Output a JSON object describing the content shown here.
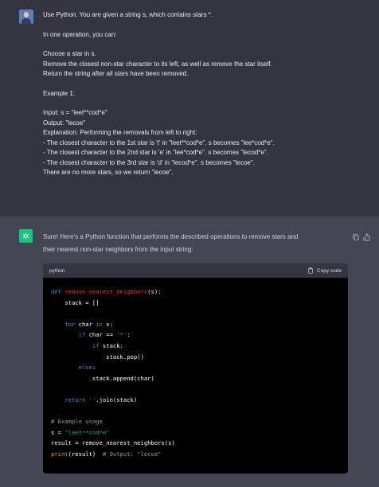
{
  "user_message": {
    "avatar": "user-avatar",
    "lines": [
      "Use Python. You are given a string s, which contains stars *.",
      "",
      "In one operation, you can:",
      "",
      "Choose a star in s.",
      "Remove the closest non-star character to its left, as well as remove the star itself.",
      "Return the string after all stars have been removed.",
      "",
      "Example 1:",
      "",
      "Input: s = \"leet**cod*e\"",
      "Output: \"lecoe\"",
      "Explanation: Performing the removals from left to right:",
      "- The closest character to the 1st star is 't' in \"leet**cod*e\". s becomes \"lee*cod*e\".",
      "- The closest character to the 2nd star is 'e' in \"lee*cod*e\". s becomes \"lecod*e\".",
      "- The closest character to the 3rd star is 'd' in \"lecod*e\". s becomes \"lecoe\".",
      "There are no more stars, so we return \"lecoe\"."
    ]
  },
  "assistant_message": {
    "avatar": "openai-logo-icon",
    "intro_line_1": "Sure! Here's a Python function that performs the described operations to remove stars and",
    "intro_line_2": "their nearest non-star neighbors from the input string:",
    "actions": [
      "copy-icon",
      "thumbs-up-icon"
    ]
  },
  "code_block": {
    "language": "python",
    "copy_label": "Copy code",
    "lines": [
      [
        [
          "kw",
          "def "
        ],
        [
          "fn",
          "remove_nearest_neighbors"
        ],
        [
          "",
          "(s):"
        ]
      ],
      [
        [
          "",
          "    stack = []"
        ]
      ],
      [
        [
          "",
          ""
        ]
      ],
      [
        [
          "kw",
          "    for "
        ],
        [
          "",
          "char "
        ],
        [
          "kw",
          "in "
        ],
        [
          "",
          "s:"
        ]
      ],
      [
        [
          "kw",
          "        if "
        ],
        [
          "",
          "char == "
        ],
        [
          "str",
          "'*'"
        ],
        [
          "",
          ":"
        ]
      ],
      [
        [
          "kw",
          "            if "
        ],
        [
          "",
          "stack:"
        ]
      ],
      [
        [
          "",
          "                stack.pop()"
        ]
      ],
      [
        [
          "kw",
          "        else"
        ],
        [
          "",
          ":"
        ]
      ],
      [
        [
          "",
          "            stack.append(char)"
        ]
      ],
      [
        [
          "",
          ""
        ]
      ],
      [
        [
          "kw",
          "    return "
        ],
        [
          "str",
          "''"
        ],
        [
          "",
          ".join(stack)"
        ]
      ],
      [
        [
          "",
          ""
        ]
      ],
      [
        [
          "cm",
          "# Example usage"
        ]
      ],
      [
        [
          "",
          "s = "
        ],
        [
          "str",
          "\"leet**cod*e\""
        ]
      ],
      [
        [
          "",
          "result = remove_nearest_neighbors(s)"
        ]
      ],
      [
        [
          "bi",
          "print"
        ],
        [
          "",
          "(result)  "
        ],
        [
          "cm",
          "# Output: \"lecoe\""
        ]
      ]
    ]
  },
  "colors": {
    "background": "#343541",
    "assistant_background": "#444654",
    "code_background": "#000000",
    "keyword": "#2e95d3",
    "function_name": "#f22c3d",
    "string": "#00a67d",
    "comment": "#999999",
    "builtin": "#e9950c"
  }
}
